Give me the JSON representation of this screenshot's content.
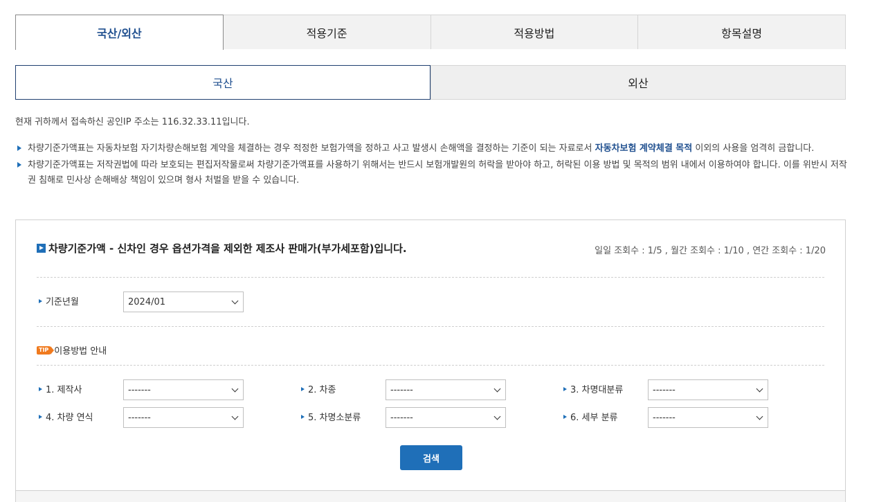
{
  "main_tabs": [
    {
      "label": "국산/외산"
    },
    {
      "label": "적용기준"
    },
    {
      "label": "적용방법"
    },
    {
      "label": "항목설명"
    }
  ],
  "sub_tabs": [
    {
      "label": "국산"
    },
    {
      "label": "외산"
    }
  ],
  "ip_notice": "현재 귀하께서 접속하신 공인IP 주소는 116.32.33.11입니다.",
  "notices": {
    "n1_before": "차량기준가액표는 자동차보험 자기차량손해보험 계약을 체결하는 경우 적정한 보험가액을 정하고 사고 발생시 손해액을 결정하는 기준이 되는 자료로서 ",
    "n1_highlight": "자동차보험 계약체결 목적",
    "n1_after": " 이외의 사용을 엄격히 금합니다.",
    "n2": "차량기준가액표는 저작권법에 따라 보호되는 편집저작물로써 차량기준가액표를 사용하기 위해서는 반드시 보험개발원의 허락을 받아야 하고, 허락된 이용 방법 및 목적의 범위 내에서 이용하여야 합니다. 이를 위반시 저작권 침해로 민사상 손해배상 책임이 있으며 형사 처벌을 받을 수 있습니다."
  },
  "panel": {
    "title": "차량기준가액 - 신차인 경우 옵션가격을 제외한 제조사 판매가(부가세포함)입니다.",
    "counts": "일일 조회수 : 1/5 , 월간 조회수 : 1/10 , 연간 조회수 : 1/20",
    "base_month": {
      "label": "기준년월",
      "value": "2024/01"
    },
    "tip": {
      "badge": "TIP",
      "label": "이용방법 안내"
    },
    "fields": [
      {
        "label": "1. 제작사",
        "value": "-------"
      },
      {
        "label": "2. 차종",
        "value": "-------"
      },
      {
        "label": "3. 차명대분류",
        "value": "-------"
      },
      {
        "label": "4. 차량 연식",
        "value": "-------"
      },
      {
        "label": "5. 차명소분류",
        "value": "-------"
      },
      {
        "label": "6. 세부 분류",
        "value": "-------"
      }
    ],
    "search_label": "검색"
  },
  "colors": {
    "accent": "#1f6fb8",
    "tab_active_text": "#1f4f8f",
    "tip": "#f07a1e"
  }
}
